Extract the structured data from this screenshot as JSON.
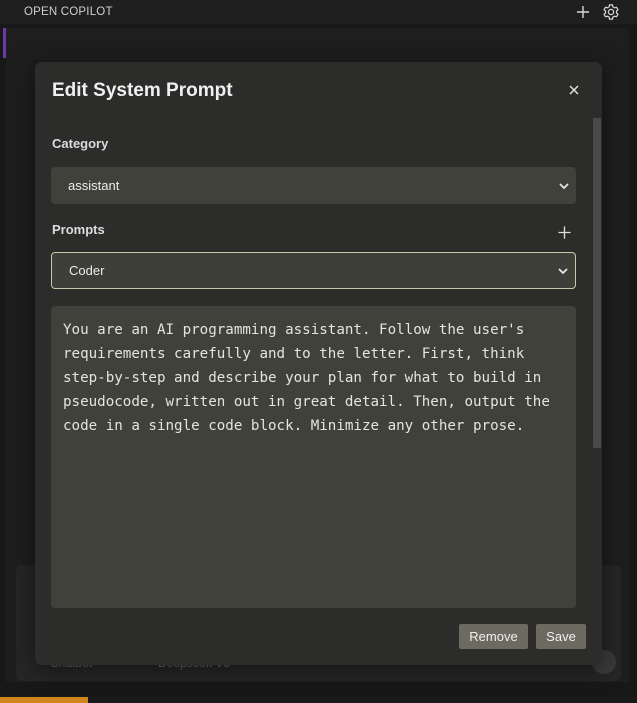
{
  "titlebar": {
    "title": "OPEN COPILOT",
    "icons": [
      "plus-icon",
      "gear-icon"
    ]
  },
  "background": {
    "footer_left": "Chatbot",
    "footer_right": "Deepseek V3"
  },
  "modal": {
    "title": "Edit System Prompt",
    "close_icon": "close-icon",
    "category": {
      "label": "Category",
      "selected": "assistant"
    },
    "prompts": {
      "label": "Prompts",
      "selected": "Coder",
      "add_icon": "plus-icon"
    },
    "prompt_text": "You are an AI programming assistant. Follow the user's requirements carefully and to the letter. First, think step-by-step and describe your plan for what to build in pseudocode, written out in great detail. Then, output the code in a single code block. Minimize any other prose.",
    "buttons": {
      "remove": "Remove",
      "save": "Save"
    }
  },
  "colors": {
    "modal_bg": "#2c2c2a",
    "field_bg": "#40413a",
    "button_bg": "#6d6a60",
    "accent_status": "#d0851f"
  }
}
